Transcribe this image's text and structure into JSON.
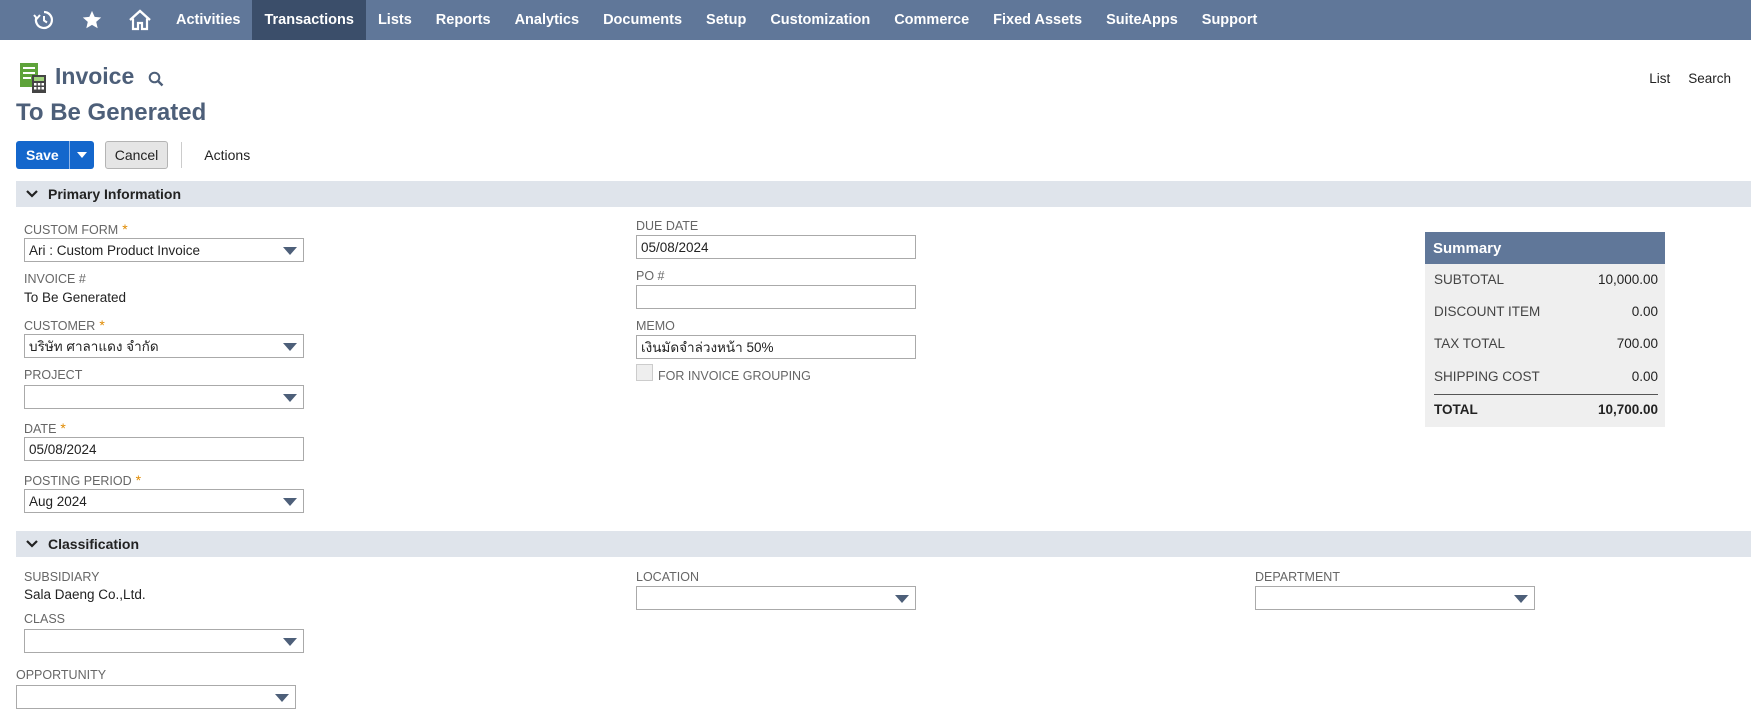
{
  "nav": {
    "items": [
      "Activities",
      "Transactions",
      "Lists",
      "Reports",
      "Analytics",
      "Documents",
      "Setup",
      "Customization",
      "Commerce",
      "Fixed Assets",
      "SuiteApps",
      "Support"
    ],
    "active": "Transactions"
  },
  "header": {
    "title": "Invoice",
    "record_name": "To Be Generated",
    "links": {
      "list": "List",
      "search": "Search"
    }
  },
  "buttons": {
    "save": "Save",
    "cancel": "Cancel",
    "actions": "Actions"
  },
  "sections": {
    "primary": "Primary Information",
    "classification": "Classification"
  },
  "primary": {
    "custom_form": {
      "label": "Custom Form",
      "value": "Ari : Custom Product Invoice"
    },
    "invoice_no": {
      "label": "Invoice #",
      "value": "To Be Generated"
    },
    "customer": {
      "label": "Customer",
      "value": "บริษัท ศาลาแดง จำกัด"
    },
    "project": {
      "label": "Project",
      "value": ""
    },
    "date": {
      "label": "Date",
      "value": "05/08/2024"
    },
    "posting_period": {
      "label": "Posting Period",
      "value": "Aug 2024"
    },
    "due_date": {
      "label": "Due Date",
      "value": "05/08/2024"
    },
    "po": {
      "label": "PO #",
      "value": ""
    },
    "memo": {
      "label": "Memo",
      "value": "เงินมัดจำล่วงหน้า 50%"
    },
    "invoice_grouping": {
      "label": "For Invoice Grouping",
      "checked": false
    }
  },
  "summary": {
    "title": "Summary",
    "rows": [
      {
        "label": "Subtotal",
        "value": "10,000.00"
      },
      {
        "label": "Discount Item",
        "value": "0.00"
      },
      {
        "label": "Tax Total",
        "value": "700.00"
      },
      {
        "label": "Shipping Cost",
        "value": "0.00"
      }
    ],
    "total": {
      "label": "Total",
      "value": "10,700.00"
    }
  },
  "classification": {
    "subsidiary": {
      "label": "Subsidiary",
      "value": "Sala Daeng Co.,Ltd."
    },
    "class": {
      "label": "Class",
      "value": ""
    },
    "location": {
      "label": "Location",
      "value": ""
    },
    "department": {
      "label": "Department",
      "value": ""
    },
    "opportunity": {
      "label": "Opportunity",
      "value": ""
    }
  },
  "colors": {
    "nav_bg": "#607799",
    "nav_active": "#3b4e6a",
    "primary_button": "#1467cc",
    "section_bg": "#dfe4eb",
    "required_star": "#e08a00"
  }
}
